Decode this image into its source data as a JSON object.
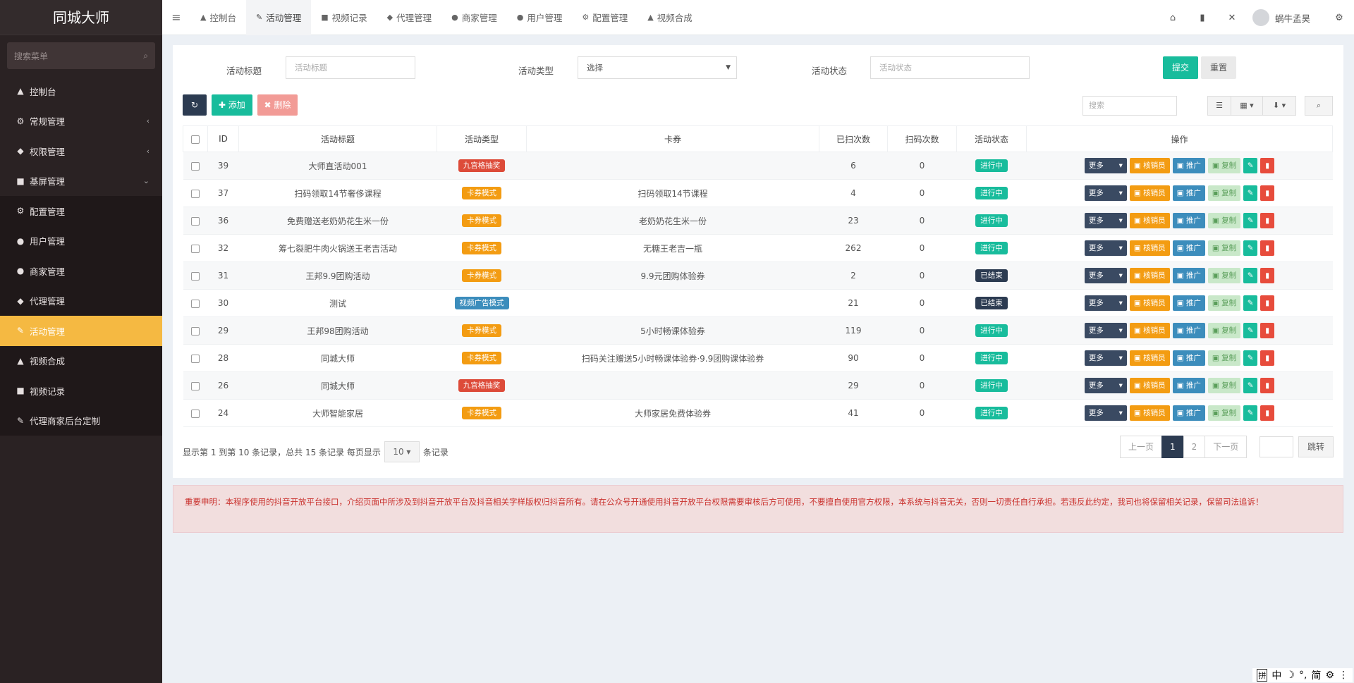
{
  "app": {
    "title": "同城大师"
  },
  "sidebar": {
    "search_placeholder": "搜索菜单",
    "items": [
      {
        "label": "控制台",
        "icon": "▲",
        "arrow": ""
      },
      {
        "label": "常规管理",
        "icon": "⚙",
        "arrow": "‹"
      },
      {
        "label": "权限管理",
        "icon": "◆",
        "arrow": "‹"
      },
      {
        "label": "基屏管理",
        "icon": "■",
        "arrow": "⌄"
      },
      {
        "label": "配置管理",
        "icon": "⚙",
        "arrow": ""
      },
      {
        "label": "用户管理",
        "icon": "●",
        "arrow": ""
      },
      {
        "label": "商家管理",
        "icon": "●",
        "arrow": ""
      },
      {
        "label": "代理管理",
        "icon": "◆",
        "arrow": ""
      },
      {
        "label": "活动管理",
        "icon": "✎",
        "arrow": ""
      },
      {
        "label": "视频合成",
        "icon": "▲",
        "arrow": ""
      },
      {
        "label": "视频记录",
        "icon": "■",
        "arrow": ""
      },
      {
        "label": "代理商家后台定制",
        "icon": "✎",
        "arrow": ""
      }
    ]
  },
  "topbar": {
    "tabs": [
      {
        "label": "控制台",
        "icon": "▲"
      },
      {
        "label": "活动管理",
        "icon": "✎"
      },
      {
        "label": "视频记录",
        "icon": "■"
      },
      {
        "label": "代理管理",
        "icon": "◆"
      },
      {
        "label": "商家管理",
        "icon": "●"
      },
      {
        "label": "用户管理",
        "icon": "●"
      },
      {
        "label": "配置管理",
        "icon": "⚙"
      },
      {
        "label": "视频合成",
        "icon": "▲"
      }
    ],
    "user_name": "蜗牛孟昊"
  },
  "filter": {
    "title_label": "活动标题",
    "title_placeholder": "活动标题",
    "type_label": "活动类型",
    "type_value": "选择",
    "status_label": "活动状态",
    "status_placeholder": "活动状态",
    "submit_label": "提交",
    "reset_label": "重置"
  },
  "toolbar": {
    "refresh_icon": "↻",
    "add_label": "✚ 添加",
    "delete_label": "✖ 删除",
    "search_placeholder": "搜索"
  },
  "table": {
    "headers": [
      "ID",
      "活动标题",
      "活动类型",
      "卡券",
      "已扫次数",
      "扫码次数",
      "活动状态",
      "操作"
    ],
    "rows": [
      {
        "id": "39",
        "title": "大师直活动001",
        "type": "九宫格抽奖",
        "type_color": "#dd4b39",
        "coupon": "",
        "scanned": "6",
        "count": "0",
        "status": "进行中",
        "status_color": "#18bc9c"
      },
      {
        "id": "37",
        "title": "扫码领取14节奢侈课程",
        "type": "卡券模式",
        "type_color": "#f39c12",
        "coupon": "扫码领取14节课程",
        "scanned": "4",
        "count": "0",
        "status": "进行中",
        "status_color": "#18bc9c"
      },
      {
        "id": "36",
        "title": "免费赠送老奶奶花生米一份",
        "type": "卡券模式",
        "type_color": "#f39c12",
        "coupon": "老奶奶花生米一份",
        "scanned": "23",
        "count": "0",
        "status": "进行中",
        "status_color": "#18bc9c"
      },
      {
        "id": "32",
        "title": "筹七裂肥牛肉火锅送王老吉活动",
        "type": "卡券模式",
        "type_color": "#f39c12",
        "coupon": "无糖王老吉一瓶",
        "scanned": "262",
        "count": "0",
        "status": "进行中",
        "status_color": "#18bc9c"
      },
      {
        "id": "31",
        "title": "王邦9.9团购活动",
        "type": "卡券模式",
        "type_color": "#f39c12",
        "coupon": "9.9元团购体验券",
        "scanned": "2",
        "count": "0",
        "status": "已结束",
        "status_color": "#2c3b51"
      },
      {
        "id": "30",
        "title": "测试",
        "type": "视频广告模式",
        "type_color": "#3c8dbc",
        "coupon": "",
        "scanned": "21",
        "count": "0",
        "status": "已结束",
        "status_color": "#2c3b51"
      },
      {
        "id": "29",
        "title": "王邦98团购活动",
        "type": "卡券模式",
        "type_color": "#f39c12",
        "coupon": "5小时畅课体验券",
        "scanned": "119",
        "count": "0",
        "status": "进行中",
        "status_color": "#18bc9c"
      },
      {
        "id": "28",
        "title": "同城大师",
        "type": "卡券模式",
        "type_color": "#f39c12",
        "coupon": "扫码关注赠送5小时畅课体验券·9.9团购课体验券",
        "scanned": "90",
        "count": "0",
        "status": "进行中",
        "status_color": "#18bc9c"
      },
      {
        "id": "26",
        "title": "同城大师",
        "type": "九宫格抽奖",
        "type_color": "#dd4b39",
        "coupon": "",
        "scanned": "29",
        "count": "0",
        "status": "进行中",
        "status_color": "#18bc9c"
      },
      {
        "id": "24",
        "title": "大师智能家居",
        "type": "卡券模式",
        "type_color": "#f39c12",
        "coupon": "大师家居免费体验券",
        "scanned": "41",
        "count": "0",
        "status": "进行中",
        "status_color": "#18bc9c"
      }
    ],
    "row_actions": {
      "more": "更多",
      "check": "核销员",
      "promote": "推广",
      "copy": "复制"
    }
  },
  "pager": {
    "info_pre": "显示第 1 到第 10 条记录，总共 15 条记录 每页显示",
    "page_size": "10",
    "info_post": "条记录",
    "prev": "上一页",
    "pages": [
      "1",
      "2"
    ],
    "next": "下一页",
    "jump": "跳转"
  },
  "notice": {
    "text": "重要申明：本程序使用的抖音开放平台接口，介绍页面中所涉及到抖音开放平台及抖音相关字样版权归抖音所有。请在公众号开通使用抖音开放平台权限需要审核后方可使用，不要擅自使用官方权限，本系统与抖音无关，否则一切责任自行承担。若违反此约定，我司也将保留相关记录，保留司法追诉！"
  },
  "ime": {
    "items": [
      "拼",
      "中",
      "☽",
      "°,",
      "简",
      "⚙",
      "⋮"
    ]
  }
}
